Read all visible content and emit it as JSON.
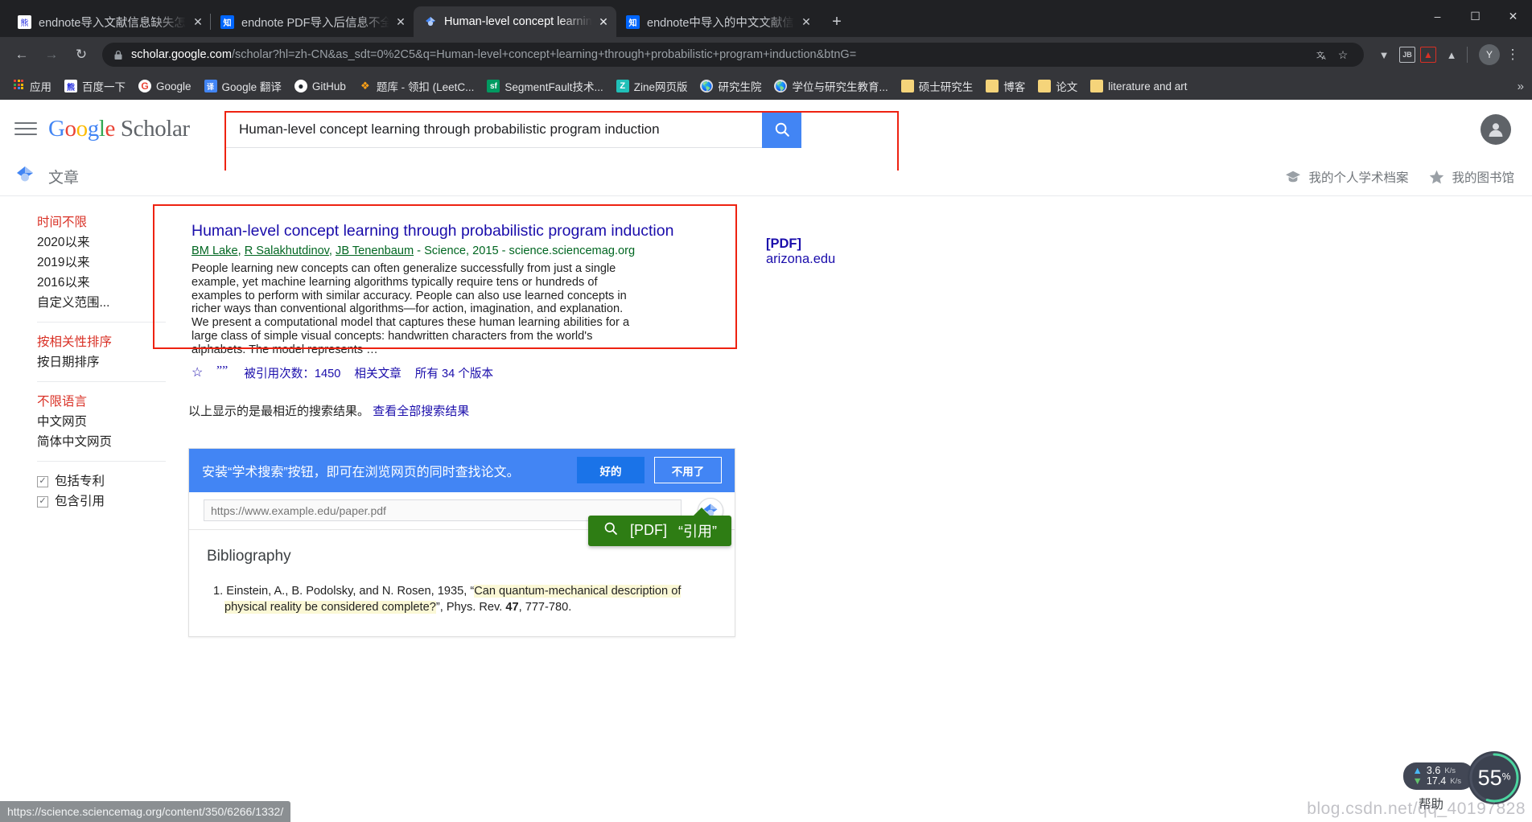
{
  "browser": {
    "tabs": [
      {
        "title": "endnote导入文献信息缺失怎么办",
        "favicon": "baidu-icon",
        "active": false
      },
      {
        "title": "endnote PDF导入后信息不全，怎",
        "favicon": "zhihu-icon",
        "active": false
      },
      {
        "title": "Human-level concept learning",
        "favicon": "google-scholar-icon",
        "active": true
      },
      {
        "title": "endnote中导入的中文文献信息不",
        "favicon": "zhihu-icon",
        "active": false
      }
    ],
    "new_tab_label": "+",
    "window_controls": {
      "minimize": "–",
      "maximize": "☐",
      "close": "✕"
    },
    "nav": {
      "back": "←",
      "forward": "→",
      "reload": "↻"
    },
    "omnibox": {
      "host": "scholar.google.com",
      "path": "/scholar?hl=zh-CN&as_sdt=0%2C5&q=Human-level+concept+learning+through+probabilistic+program+induction&btnG=",
      "lock": "lock-icon",
      "translate": "translate-icon",
      "bookmark_star": "☆"
    },
    "extensions": [
      "filter-icon",
      "JB",
      "PDF",
      "adblock-icon"
    ],
    "profile_letter": "Y",
    "menu": "⋮",
    "bookmarks": [
      {
        "label": "应用",
        "icon": "apps-grid-icon"
      },
      {
        "label": "百度一下",
        "icon": "baidu-icon"
      },
      {
        "label": "Google",
        "icon": "google-icon"
      },
      {
        "label": "Google 翻译",
        "icon": "google-translate-icon"
      },
      {
        "label": "GitHub",
        "icon": "github-icon"
      },
      {
        "label": "题库 - 领扣 (LeetC...",
        "icon": "leetcode-icon"
      },
      {
        "label": "SegmentFault技术...",
        "icon": "segmentfault-icon"
      },
      {
        "label": "Zine网页版",
        "icon": "zine-icon"
      },
      {
        "label": "研究生院",
        "icon": "globe-icon"
      },
      {
        "label": "学位与研究生教育...",
        "icon": "globe-icon"
      },
      {
        "label": "硕士研究生",
        "icon": "folder-icon"
      },
      {
        "label": "博客",
        "icon": "folder-icon"
      },
      {
        "label": "论文",
        "icon": "folder-icon"
      },
      {
        "label": "literature and art",
        "icon": "folder-icon"
      }
    ],
    "bookmarks_overflow": "»",
    "status_url": "https://science.sciencemag.org/content/350/6266/1332/"
  },
  "scholar": {
    "logo": {
      "g1": "G",
      "o1": "o",
      "o2": "o",
      "g2": "g",
      "l": "l",
      "e": "e",
      "scholar": "Scholar"
    },
    "search": {
      "value": "Human-level concept learning through probabilistic program induction",
      "placeholder": "",
      "button_icon": "search-icon"
    },
    "subheader": {
      "title": "文章",
      "icon": "scholar-diamond-icon",
      "profile_link": "我的个人学术档案",
      "library_link": "我的图书馆"
    },
    "sidebar": {
      "groups": [
        {
          "items": [
            {
              "label": "时间不限",
              "selected": true
            },
            {
              "label": "2020以来",
              "selected": false
            },
            {
              "label": "2019以来",
              "selected": false
            },
            {
              "label": "2016以来",
              "selected": false
            },
            {
              "label": "自定义范围...",
              "selected": false
            }
          ]
        },
        {
          "items": [
            {
              "label": "按相关性排序",
              "selected": true
            },
            {
              "label": "按日期排序",
              "selected": false
            }
          ]
        },
        {
          "items": [
            {
              "label": "不限语言",
              "selected": true
            },
            {
              "label": "中文网页",
              "selected": false
            },
            {
              "label": "简体中文网页",
              "selected": false
            }
          ]
        }
      ],
      "checkboxes": [
        {
          "label": "包括专利",
          "checked": true
        },
        {
          "label": "包含引用",
          "checked": true
        }
      ]
    },
    "result": {
      "title": "Human-level concept learning through probabilistic program induction",
      "authors": [
        "BM Lake",
        "R Salakhutdinov",
        "JB Tenenbaum"
      ],
      "venue": " - Science, 2015 - science.sciencemag.org",
      "snippet": "People learning new concepts can often generalize successfully from just a single example, yet machine learning algorithms typically require tens or hundreds of examples to perform with similar accuracy. People can also use learned concepts in richer ways than conventional algorithms—for action, imagination, and explanation. We present a computational model that captures these human learning abilities for a large class of simple visual concepts: handwritten characters from the world's alphabets. The model represents …",
      "actions": {
        "star_icon": "☆",
        "quote_icon": "””",
        "cited_by": "被引用次数：1450",
        "related": "相关文章",
        "versions": "所有 34 个版本"
      },
      "pdf_tag": "[PDF]",
      "pdf_source": "arizona.edu"
    },
    "note": {
      "text": "以上显示的是最相近的搜索结果。",
      "link": "查看全部搜索结果"
    },
    "promo": {
      "banner_text": "安装“学术搜索”按钮，即可在浏览网页的同时查找论文。",
      "accept_label": "好的",
      "decline_label": "不用了",
      "url_placeholder": "https://www.example.edu/paper.pdf",
      "badge_icon": "scholar-diamond-icon",
      "doc_heading": "Bibliography",
      "reference_prefix": "1. Einstein, A., B. Podolsky, and N. Rosen, 1935, “",
      "reference_highlight": "Can quantum-mechanical description of physical reality be considered complete?",
      "reference_suffix": "”, Phys. Rev. ",
      "reference_bold": "47",
      "reference_tail": ", 777-780.",
      "tooltip": {
        "icon": "search-icon",
        "pdf": "[PDF]",
        "cite": "“引用”"
      }
    },
    "help_label": "帮助"
  },
  "overlay": {
    "watermark": "blog.csdn.net/qq_40197828",
    "netspeed": {
      "up_value": "3.6",
      "up_unit": "K/s",
      "down_value": "17.4",
      "down_unit": "K/s"
    },
    "cpu": {
      "value": "55",
      "unit": "%"
    }
  },
  "colors": {
    "accent_blue": "#4285f4",
    "link_blue": "#1a0dab",
    "green": "#006621",
    "highlight_red": "#ee2211",
    "tooltip_green": "#2e7d14"
  }
}
